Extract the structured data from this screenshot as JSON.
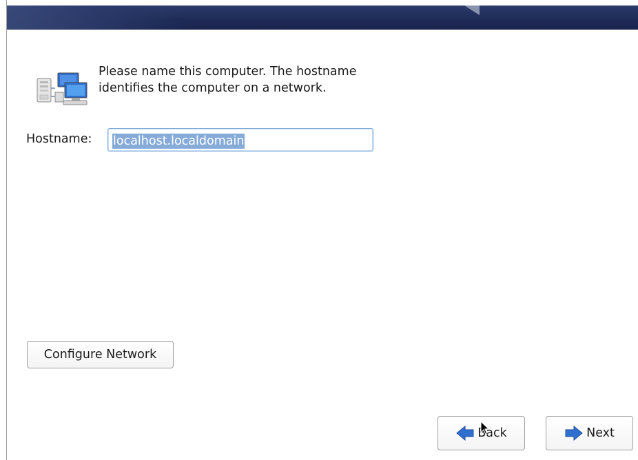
{
  "intro": {
    "text": "Please name this computer.  The hostname identifies the computer on a network."
  },
  "hostname": {
    "label": "Hostname:",
    "value": "localhost.localdomain"
  },
  "buttons": {
    "configure_network": "Configure Network",
    "back": "Back",
    "next": "Next"
  },
  "icons": {
    "network": "network-computers-icon",
    "back": "arrow-left-icon",
    "next": "arrow-right-icon"
  },
  "colors": {
    "banner": "#1d2a55",
    "selection": "#86abd9",
    "arrow_blue": "#2f6fcf"
  }
}
